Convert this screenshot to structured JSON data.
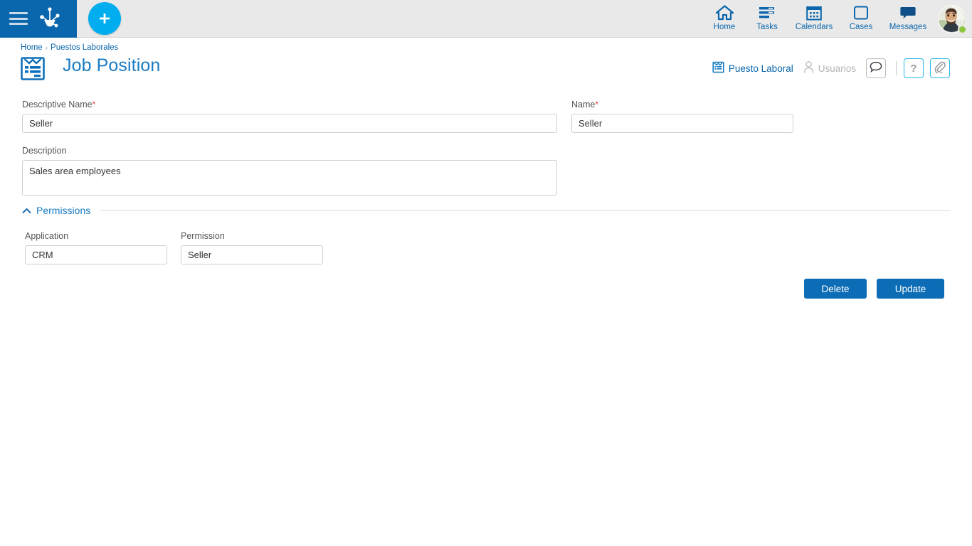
{
  "topbar": {
    "menu_icon": "hamburger-icon",
    "logo_icon": "molecule-logo-icon",
    "add_button_icon": "plus-icon",
    "nav": [
      {
        "label": "Home",
        "icon": "home-icon"
      },
      {
        "label": "Tasks",
        "icon": "tasks-icon"
      },
      {
        "label": "Calendars",
        "icon": "calendar-icon"
      },
      {
        "label": "Cases",
        "icon": "cases-square-icon"
      },
      {
        "label": "Messages",
        "icon": "chat-bubble-icon"
      }
    ],
    "avatar": {
      "name": "user-avatar",
      "status": "online",
      "status_color": "#8cc63e"
    },
    "brand_color": "#0a66ad",
    "accent_color": "#00aeef",
    "bar_background": "#e9e9e9"
  },
  "breadcrumb": {
    "items": [
      "Home",
      "Puestos Laborales"
    ],
    "separator": "›"
  },
  "page": {
    "title": "Job Position",
    "icon": "clipboard-icon",
    "title_color": "#1a7cc4"
  },
  "head_tools": {
    "tabs": [
      {
        "label": "Puesto Laboral",
        "icon": "clipboard-small-icon",
        "active": true
      },
      {
        "label": "Usuarios",
        "icon": "user-icon",
        "active": false
      }
    ],
    "buttons": [
      {
        "name": "comments-button",
        "icon": "chat-bubble-outline-icon",
        "style": "gray"
      },
      {
        "name": "help-button",
        "icon": "question-mark-icon",
        "label": "?",
        "style": "cyan"
      },
      {
        "name": "attachments-button",
        "icon": "paperclip-icon",
        "style": "cyan"
      }
    ]
  },
  "form": {
    "descriptive_name": {
      "label": "Descriptive Name",
      "required": true,
      "required_marker": "*",
      "value": "Seller",
      "placeholder": ""
    },
    "name": {
      "label": "Name",
      "required": true,
      "required_marker": "*",
      "value": "Seller",
      "placeholder": ""
    },
    "description": {
      "label": "Description",
      "value": "Sales area employees",
      "placeholder": ""
    }
  },
  "permissions_section": {
    "title": "Permissions",
    "collapse_icon": "chevron-up-icon",
    "expanded": true,
    "fields": {
      "application": {
        "label": "Application",
        "value": "CRM",
        "placeholder": ""
      },
      "permission": {
        "label": "Permission",
        "value": "Seller",
        "placeholder": ""
      }
    }
  },
  "actions": {
    "delete_label": "Delete",
    "update_label": "Update",
    "button_color": "#0c6cb5"
  }
}
